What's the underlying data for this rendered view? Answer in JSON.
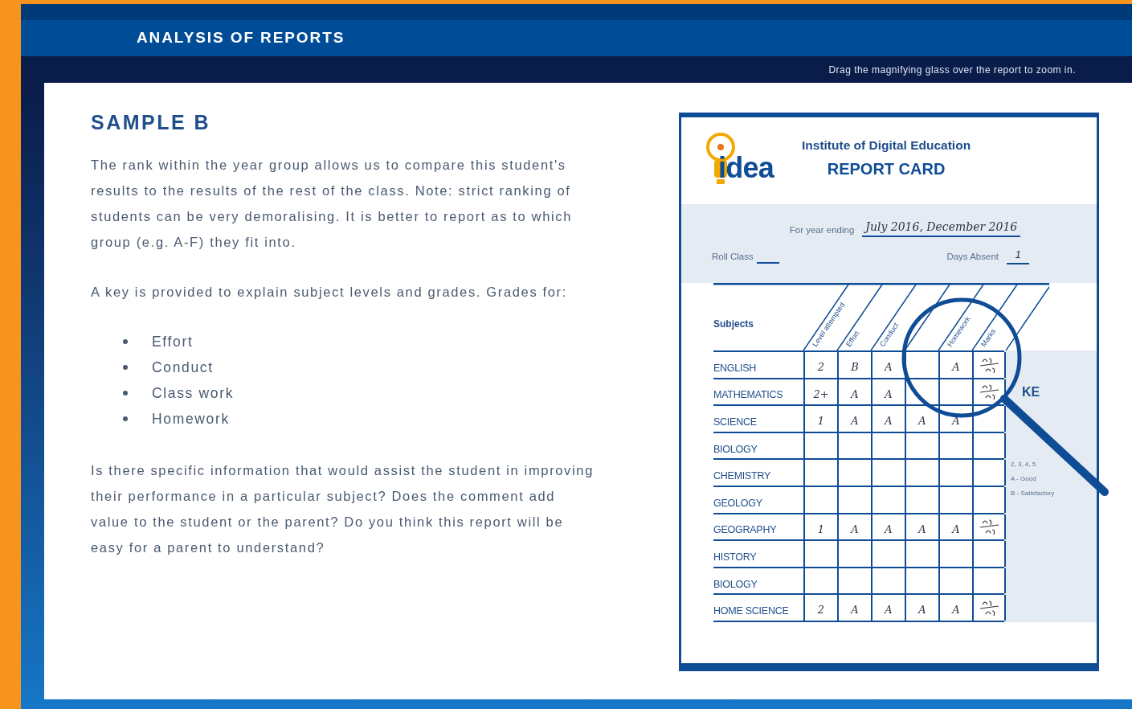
{
  "header": {
    "title": "ANALYSIS OF REPORTS"
  },
  "instruction": "Drag the magnifying glass over the report to zoom in.",
  "content": {
    "heading": "SAMPLE B",
    "paragraphs": [
      "The rank within the year group allows us to compare this student's results to the results of the rest of the class. Note: strict ranking of students can be very demoralising. It is better to report as to which group (e.g. A-F)  they fit into.",
      "A key is provided to explain subject levels and grades. Grades for:"
    ],
    "bullets": [
      "Effort",
      "Conduct",
      "Class work",
      "Homework"
    ],
    "closing": "Is there specific information that would assist the student in improving their performance in a particular subject? Does the comment add value to the student or the parent? Do you think this report will be easy for a parent to understand?"
  },
  "report_card": {
    "logo": "idea",
    "institute": "Institute of Digital Education",
    "title": "REPORT CARD",
    "year_label": "For year ending",
    "year_value": "July 2016, December 2016",
    "class_label": "Roll Class",
    "absent_label": "Days Absent",
    "absent_value": "1",
    "subjects_label": "Subjects",
    "columns": {
      "level": "Level attempted",
      "effort": "Effort",
      "conduct": "Conduct",
      "homework": "Homework",
      "marks": "Marks"
    },
    "rows": [
      {
        "subject": "ENGLISH",
        "level": "2",
        "effort": "B",
        "conduct": "A",
        "homework": "A",
        "marked": true
      },
      {
        "subject": "MATHEMATICS",
        "level": "2+",
        "effort": "A",
        "conduct": "A",
        "marked": true
      },
      {
        "subject": "SCIENCE",
        "level": "1",
        "effort": "A",
        "conduct": "A",
        "column_4": "A",
        "homework": "A",
        "marked": false
      },
      {
        "subject": "BIOLOGY",
        "marked": false
      },
      {
        "subject": "CHEMISTRY",
        "marked": false
      },
      {
        "subject": "GEOLOGY",
        "marked": false
      },
      {
        "subject": "GEOGRAPHY",
        "level": "1",
        "effort": "A",
        "conduct": "A",
        "column_4": "A",
        "homework": "A",
        "marked": true
      },
      {
        "subject": "HISTORY",
        "marked": false
      },
      {
        "subject": "BIOLOGY",
        "marked": false
      },
      {
        "subject": "HOME SCIENCE",
        "level": "2",
        "effort": "A",
        "conduct": "A",
        "column_4": "A",
        "homework": "A",
        "marked": true
      }
    ],
    "key_heading": "KE",
    "key_items": [
      "2, 3, 4, 5",
      "A - Good",
      "B - Satisfactory"
    ]
  }
}
